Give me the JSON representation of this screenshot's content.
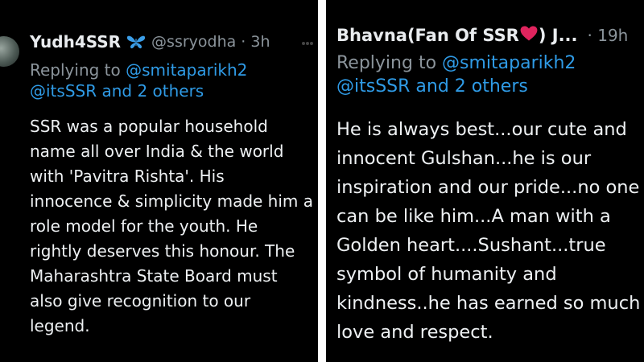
{
  "left_tweet": {
    "author_name": "Yudh4SSR",
    "handle_time": "@ssryodha · 3h",
    "replying_to_prefix": "Replying to ",
    "mention_1": "@smitaparikh2",
    "mention_2": "@itsSSR and 2 others",
    "text_lines": [
      "SSR was a popular household",
      "name all over India & the world",
      "with 'Pavitra Rishta'. His",
      "innocence & simplicity made him a",
      "role model for the youth. He",
      "rightly deserves this honour. The",
      "Maharashtra State Board must",
      "also give recognition to our",
      "legend."
    ],
    "icons": [
      "butterfly-icon",
      "more-options-icon"
    ]
  },
  "right_tweet": {
    "author_name_before_icon": "Bhavna(Fan Of SSR",
    "author_name_after_icon": ") J...",
    "handle_time": "· 19h",
    "replying_to_prefix": "Replying to ",
    "mention_1": "@smitaparikh2",
    "mention_2": "@itsSSR and 2 others",
    "text_lines": [
      "He is always best...our cute and",
      "innocent Gulshan...he is our",
      "inspiration and our pride...no one",
      "can be like him...A man with a",
      "Golden heart....Sushant...true",
      "symbol of humanity and",
      "kindness..he has earned so much",
      "love and respect."
    ],
    "icons": [
      "heart-icon"
    ]
  },
  "colors": {
    "background": "#000000",
    "name_text": "#e9ecef",
    "secondary_text": "#8b949b",
    "mention_link": "#2f9be6",
    "heart": "#e0245e",
    "butterfly": "#3b9ee8"
  }
}
